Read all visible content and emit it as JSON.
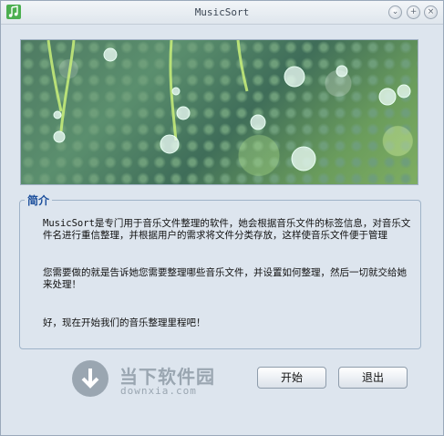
{
  "window": {
    "title": "MusicSort"
  },
  "banner": {
    "image": "water-drops-on-grass"
  },
  "intro": {
    "group_title": "简介",
    "paragraphs": [
      "MusicSort是专门用于音乐文件整理的软件，她会根据音乐文件的标签信息，对音乐文件名进行重信整理，并根据用户的需求将文件分类存放，这样使音乐文件便于管理",
      "您需要做的就是告诉她您需要整理哪些音乐文件，并设置如何整理，然后一切就交给她来处理！",
      "好，现在开始我们的音乐整理里程吧！"
    ]
  },
  "watermark": {
    "name": "当下软件园",
    "url": "downxia.com"
  },
  "buttons": {
    "start": "开始",
    "exit": "退出"
  },
  "colors": {
    "window_bg": "#dde5ee",
    "group_title": "#1c4f9c",
    "watermark": "#9aa6b1"
  }
}
